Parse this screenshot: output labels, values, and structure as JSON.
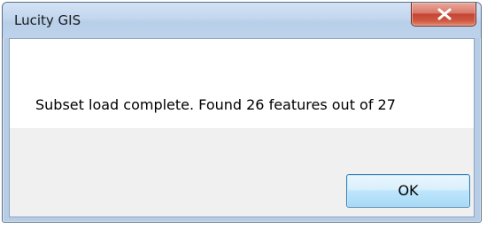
{
  "window": {
    "title": "Lucity GIS",
    "close_icon": "close-x-icon"
  },
  "message": {
    "text": "Subset load complete.  Found 26 features out of 27"
  },
  "buttons": {
    "ok_label": "OK"
  },
  "colors": {
    "titlebar": "#c2d6ee",
    "close_button": "#c44432",
    "ok_button": "#bee6fd",
    "footer": "#f0f0f0"
  }
}
